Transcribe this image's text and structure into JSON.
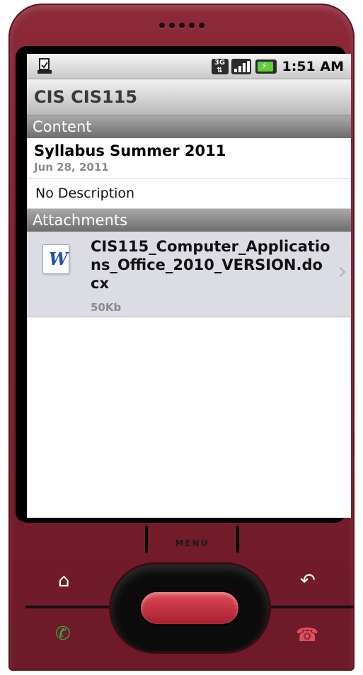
{
  "statusbar": {
    "network_label": "3G",
    "time": "1:51 AM",
    "icons": [
      "download-icon",
      "3g-icon",
      "signal-icon",
      "battery-icon"
    ]
  },
  "title": "CIS CIS115",
  "content_section": {
    "header": "Content",
    "item_title": "Syllabus Summer 2011",
    "item_date": "Jun 28, 2011",
    "description": "No Description"
  },
  "attachments_section": {
    "header": "Attachments",
    "file_name": "CIS115_Computer_Applications_Office_2010_VERSION.docx",
    "file_size": "50Kb",
    "file_icon_letter": "W"
  },
  "hardware": {
    "menu_label": "MENU"
  },
  "colors": {
    "phone_body": "#7a1f2e",
    "attachment_bg": "#dcdce4",
    "header_gray": "#6d6d6d"
  }
}
